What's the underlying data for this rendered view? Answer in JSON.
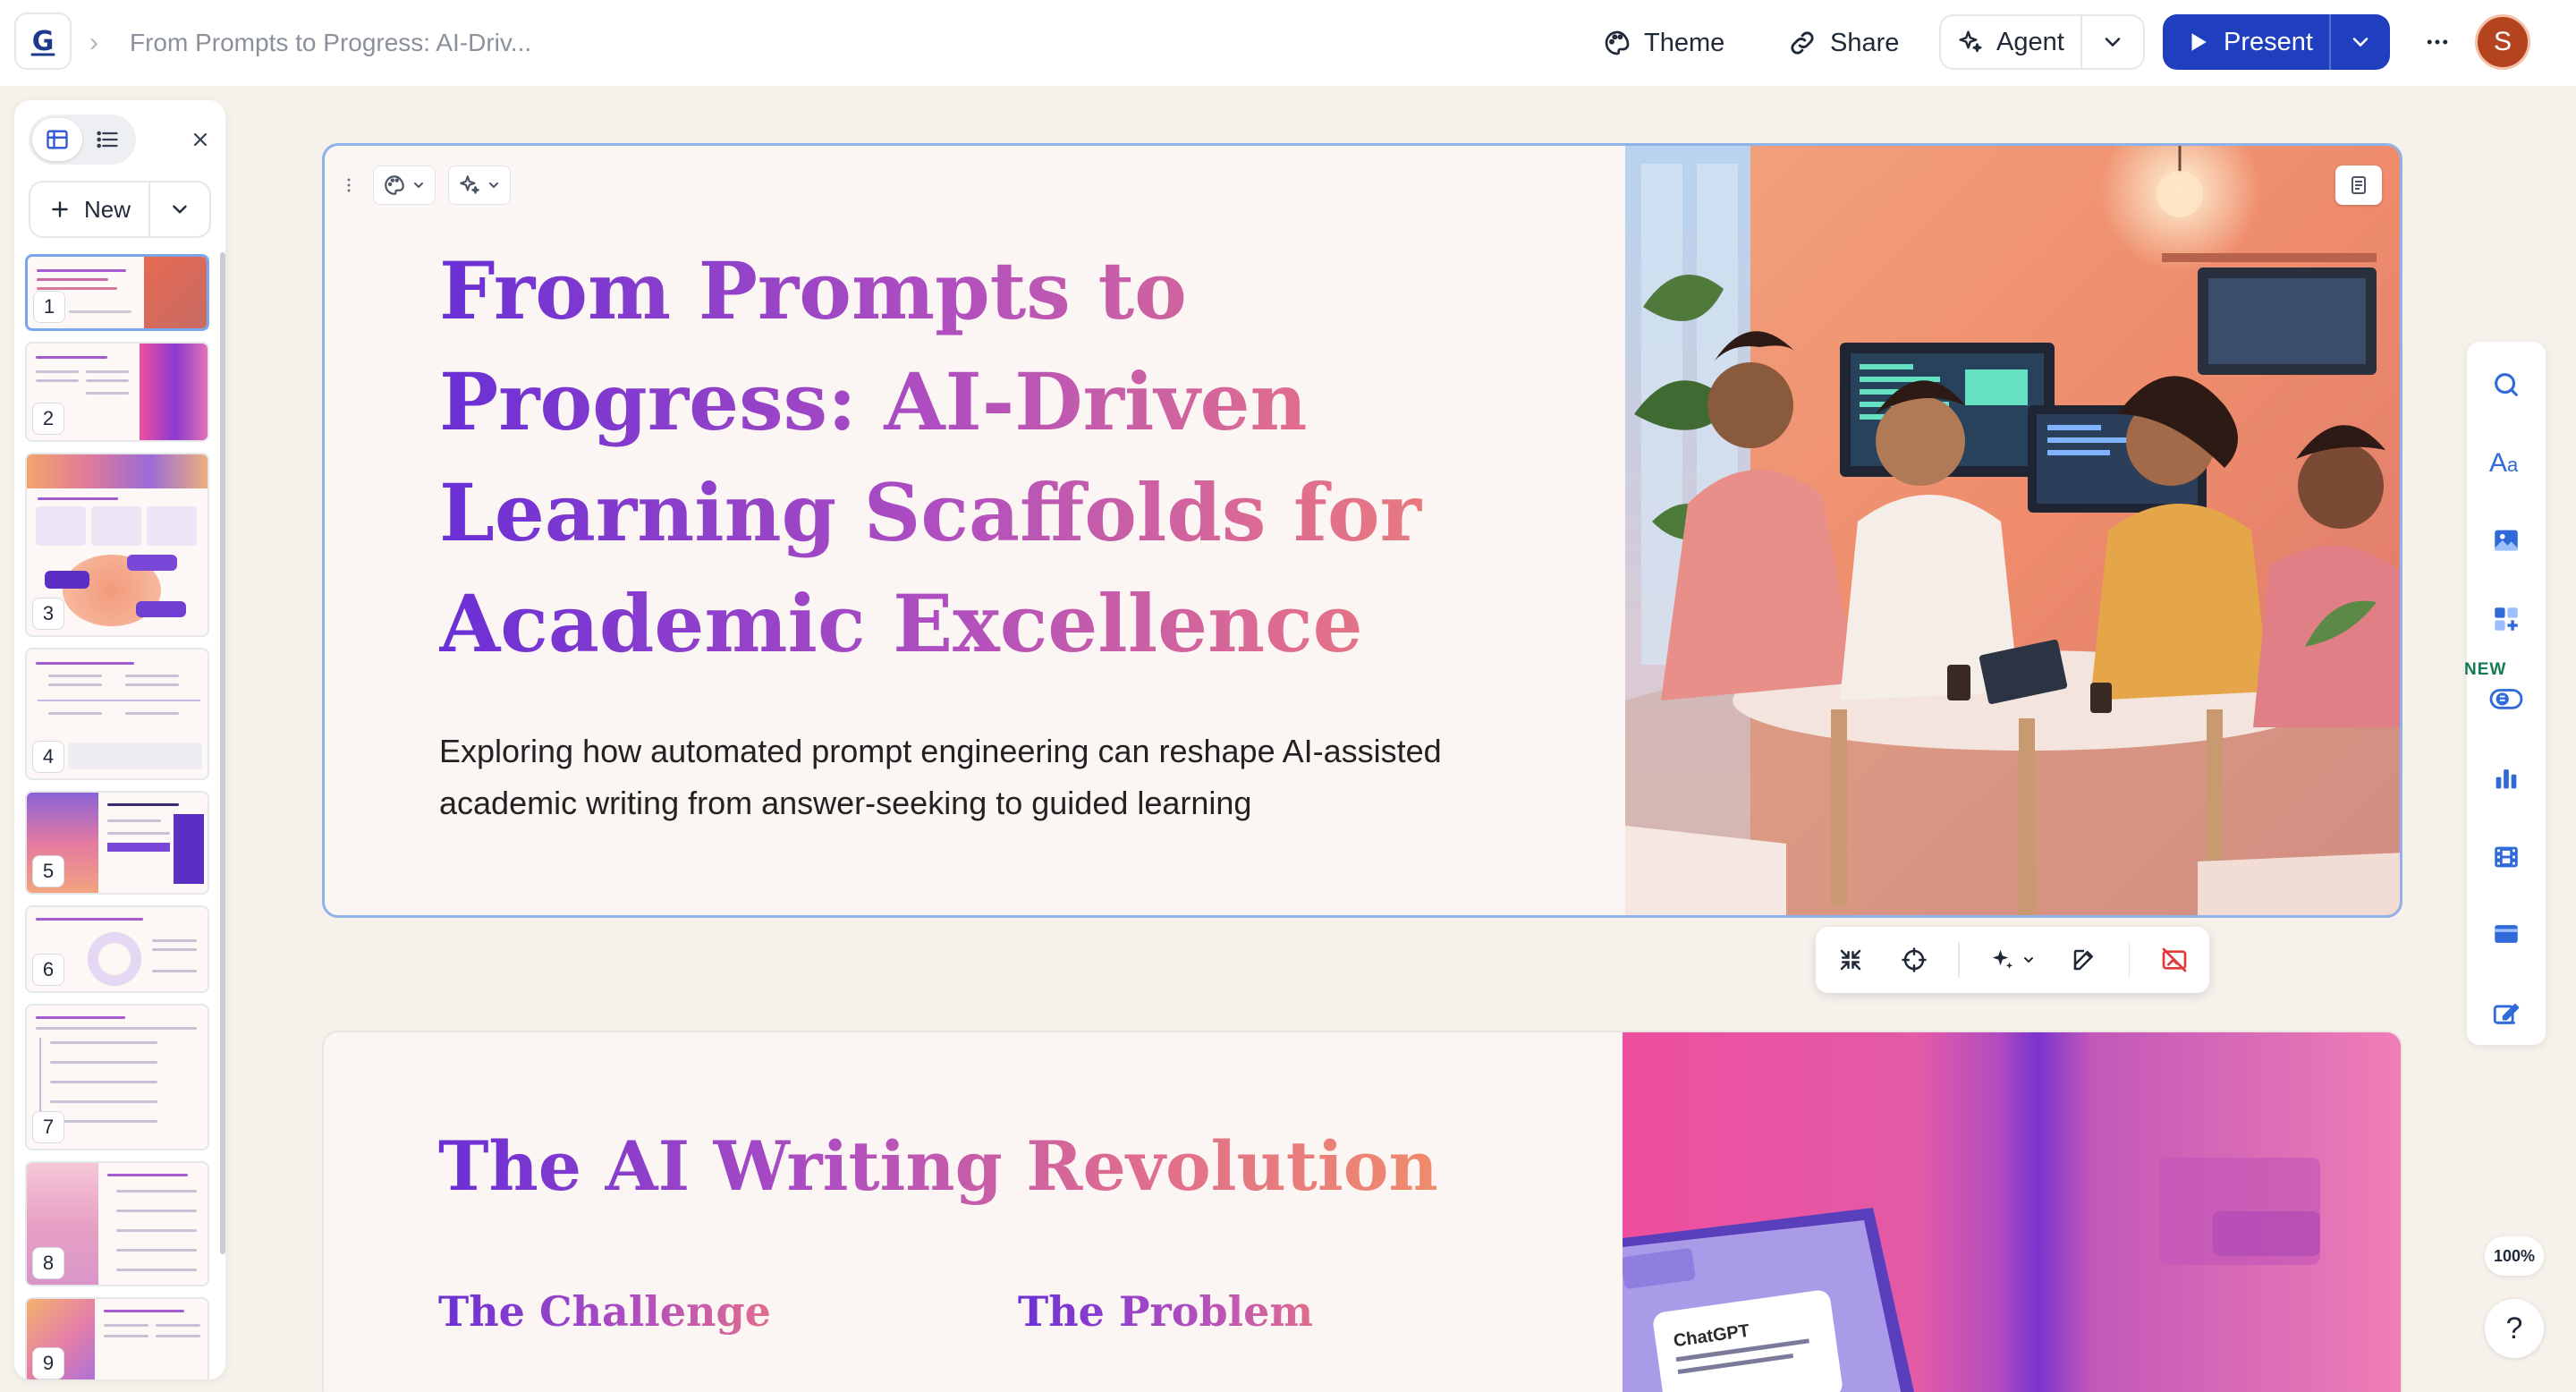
{
  "topbar": {
    "breadcrumb": "From Prompts to Progress: AI-Driv...",
    "theme_label": "Theme",
    "share_label": "Share",
    "agent_label": "Agent",
    "present_label": "Present",
    "avatar_initial": "S",
    "present_color": "#1f3fbf"
  },
  "sidebar": {
    "new_label": "New",
    "thumbnails": [
      "1",
      "2",
      "3",
      "4",
      "5",
      "6",
      "7",
      "8",
      "9"
    ]
  },
  "slide1": {
    "title": "From Prompts to Progress: AI-Driven Learning Scaffolds for Academic Excellence",
    "subtitle": "Exploring how automated prompt engineering can reshape AI-assisted academic writing from answer-seeking to guided learning"
  },
  "slide2": {
    "title": "The AI Writing Revolution",
    "challenge_heading": "The Challenge",
    "problem_heading": "The Problem",
    "chatgpt_label": "ChatGPT"
  },
  "rail": {
    "new_tag": "NEW",
    "zoom": "100%",
    "help": "?"
  },
  "colors": {
    "accent": "#1f3fbf",
    "title_gradient_start": "#6a2fd6",
    "title_gradient_end": "#f08b6b",
    "selection_border": "#8fb2e8"
  }
}
